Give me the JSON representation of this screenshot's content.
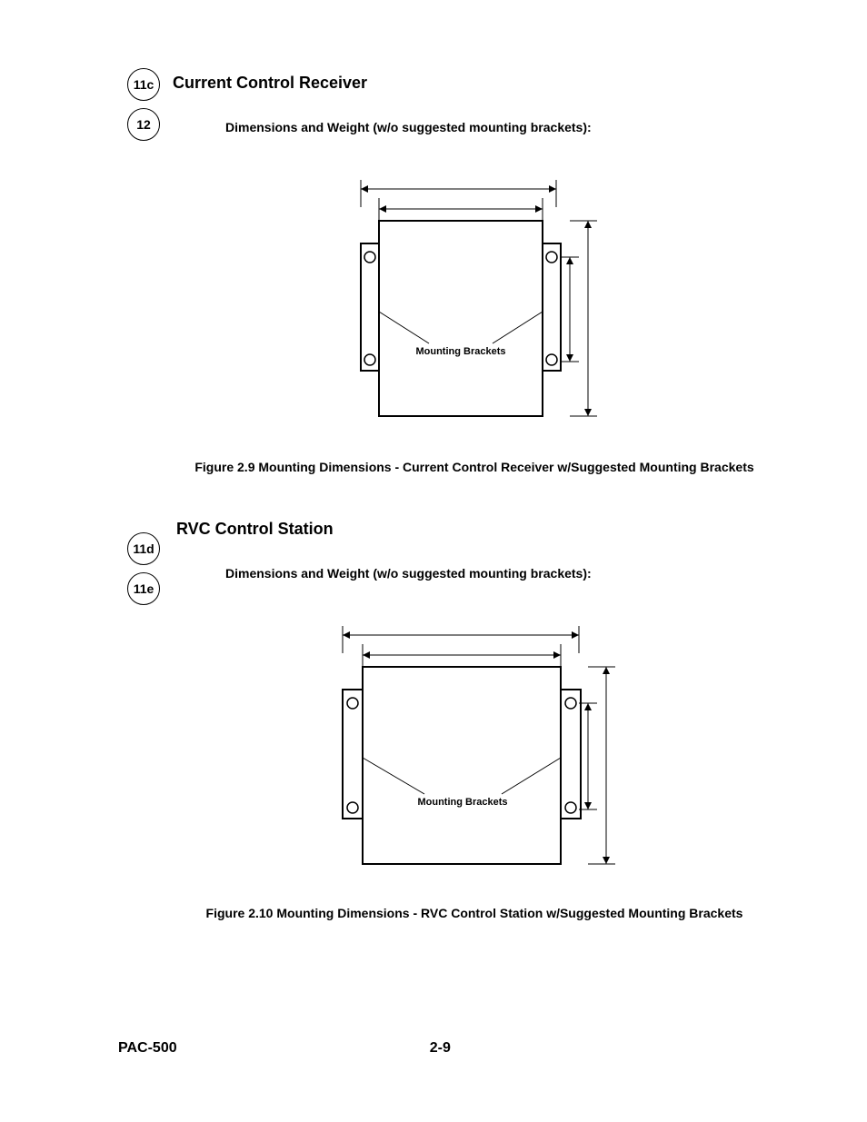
{
  "callouts": {
    "group1": {
      "a": "11c",
      "b": "12"
    },
    "group2": {
      "a": "11d",
      "b": "11e"
    }
  },
  "section1": {
    "heading": "Current Control Receiver",
    "subline": "Dimensions and Weight (w/o suggested mounting brackets):",
    "figure_label": "Mounting Brackets",
    "caption": "Figure 2.9  Mounting Dimensions - Current Control Receiver w/Suggested Mounting Brackets"
  },
  "section2": {
    "heading": "RVC Control Station",
    "subline": "Dimensions and Weight (w/o suggested mounting brackets):",
    "figure_label": "Mounting Brackets",
    "caption": "Figure 2.10  Mounting Dimensions - RVC Control Station w/Suggested Mounting Brackets"
  },
  "footer": {
    "left": "PAC-500",
    "center": "2-9"
  }
}
